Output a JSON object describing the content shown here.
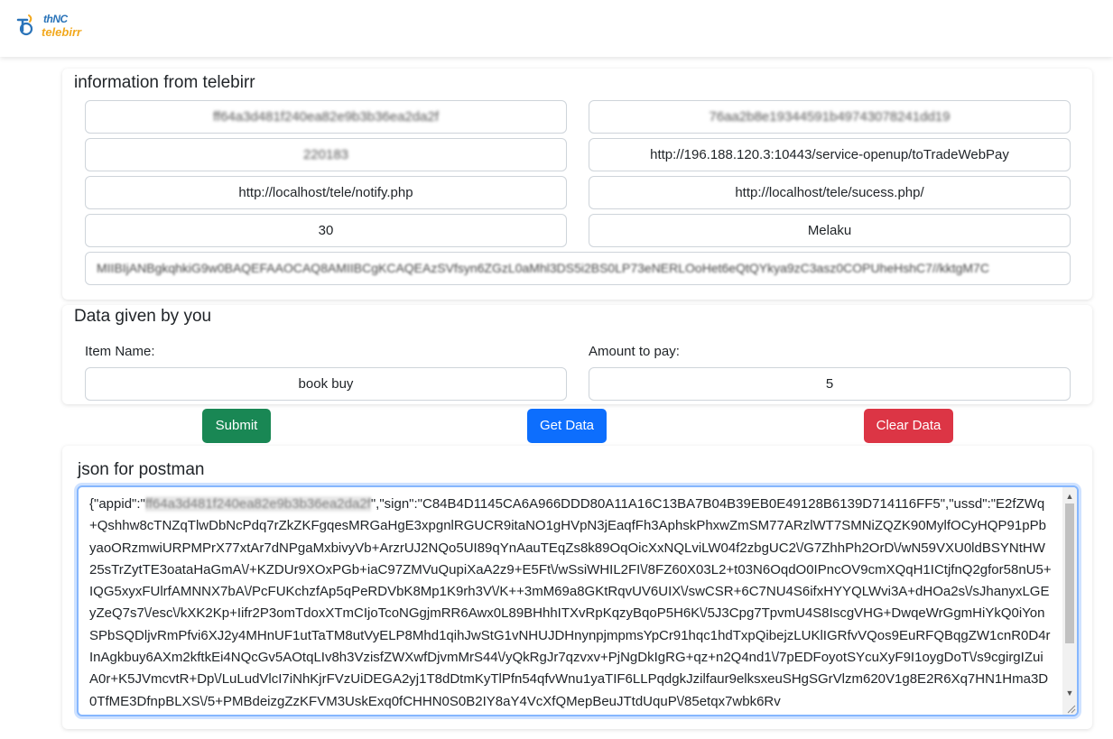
{
  "header": {
    "logo_line1": "thNC",
    "logo_line2": "telebirr"
  },
  "telebirr_info": {
    "title": "information from telebirr",
    "app_id": "ff64a3d481f240ea82e9b3b36ea2da2f",
    "app_key": "76aa2b8e19344591b49743078241dd19",
    "short_code": "220183",
    "api_url": "http://196.188.120.3:10443/service-openup/toTradeWebPay",
    "notify_url": "http://localhost/tele/notify.php",
    "return_url": "http://localhost/tele/sucess.php/",
    "timeout": "30",
    "receiver_name": "Melaku",
    "public_key": "MIIBIjANBgkqhkiG9w0BAQEFAAOCAQ8AMIIBCgKCAQEAzSVfsyn6ZGzL0aMhl3DS5i2BS0LP73eNERLOoHet6eQtQYkya9zC3asz0COPUheHshC7//kktgM7C"
  },
  "user_data": {
    "title": "Data given by you",
    "item_name_label": "Item Name:",
    "item_name_value": "book buy",
    "amount_label": "Amount to pay:",
    "amount_value": "5"
  },
  "buttons": {
    "submit": "Submit",
    "get_data": "Get Data",
    "clear_data": "Clear Data"
  },
  "postman": {
    "title": "json for postman",
    "prefix": "{\"appid\":\"",
    "appid_blurred": "ff64a3d481f240ea82e9b3b36ea2da2f",
    "rest": "\",\"sign\":\"C84B4D1145CA6A966DDD80A11A16C13BA7B04B39EB0E49128B6139D714116FF5\",\"ussd\":\"E2fZWq+Qshhw8cTNZqTlwDbNcPdq7rZkZKFgqesMRGaHgE3xpgnlRGUCR9itaNO1gHVpN3jEaqfFh3AphskPhxwZmSM77ARzlWT7SMNiZQZK90MylfOCyHQP91pPbyaoORzmwiURPMPrX77xtAr7dNPgaMxbivyVb+ArzrUJ2NQo5UI89qYnAauTEqZs8k89OqOicXxNQLviLW04f2zbgUC2\\/G7ZhhPh2OrD\\/wN59VXU0ldBSYNtHW25sTrZytTE3oataHaGmA\\/+KZDUr9XOxPGb+iaC97ZMVuQupiXaA2z9+E5Ft\\/wSsiWHIL2FI\\/8FZ60X03L2+t03N6OqdO0IPncOV9cmXQqH1ICtjfnQ2gfor58nU5+IQG5xyxFUlrfAMNNX7bA\\/PcFUKchzfAp5qPeRDVbK8Mp1K9rh3V\\/K++3mM69a8GKtRqvUV6UIX\\/swCSR+6C7NU4S6ifxHYYQLWvi3A+dHOa2s\\/sJhanyxLGEyZeQ7s7\\/esc\\/kXK2Kp+Iifr2P3omTdoxXTmCIjoTcoNGgjmRR6Awx0L89BHhhITXvRpKqzyBqoP5H6K\\/5J3Cpg7TpvmU4S8IscgVHG+DwqeWrGgmHiYkQ0iYonSPbSQDljvRmPfvi6XJ2y4MHnUF1utTaTM8utVyELP8Mhd1qihJwStG1vNHUJDHnynpjmpmsYpCr91hqc1hdTxpQibejzLUKlIGRfvVQos9EuRFQBqgZW1cnR0D4rInAgkbuy6AXm2kftkEi4NQcGv5AOtqLIv8h3VzisfZWXwfDjvmMrS44\\/yQkRgJr7qzvxv+PjNgDkIgRG+qz+n2Q4nd1\\/7pEDFoyotSYcuXyF9I1oygDoT\\/s9cgirgIZuiA0r+K5JVmcvtR+Dp\\/LuLudVlcI7iNhKjrFVzUiDEGA2yj1T8dDtmKyTlPfn54qfvWnu1yaTIF6LLPqdgkJzilfaur9elksxeuSHgSGrVlzm620V1g8E2R6Xq7HN1Hma3D0TfME3DfnpBLXS\\/5+PMBdeizgZzKFVM3UskExq0fCHHN0S0B2IY8aY4VcXfQMepBeuJTtdUquP\\/85etqx7wbk6Rv"
  },
  "colors": {
    "submit_bg": "#198754",
    "get_data_bg": "#0d6efd",
    "clear_data_bg": "#dc3545",
    "logo_blue": "#2b74b9",
    "logo_orange": "#f2a81d"
  }
}
